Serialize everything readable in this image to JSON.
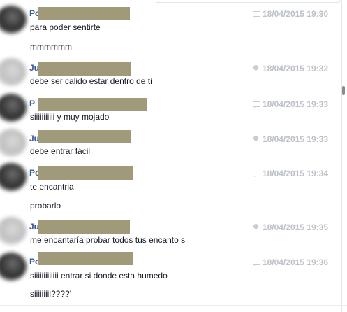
{
  "messages": [
    {
      "sender": "Po",
      "avatar": "dark",
      "icon": "chat",
      "timestamp": "18/04/2015 19:30",
      "lines": [
        "para poder sentirte",
        "mmmmmm"
      ]
    },
    {
      "sender": "Ju",
      "avatar": "light",
      "icon": "pin",
      "timestamp": "18/04/2015 19:32",
      "lines": [
        "debe ser calido estar dentro de ti"
      ]
    },
    {
      "sender": "P",
      "avatar": "dark",
      "icon": "chat",
      "timestamp": "18/04/2015 19:33",
      "lines": [
        "siiiiiiiiiii y muy mojado"
      ]
    },
    {
      "sender": "Ju",
      "avatar": "light",
      "icon": "pin",
      "timestamp": "18/04/2015 19:33",
      "lines": [
        "debe entrar fácil"
      ]
    },
    {
      "sender": "Po",
      "avatar": "dark",
      "icon": "chat",
      "timestamp": "18/04/2015 19:34",
      "lines": [
        "te encantria",
        "probarlo"
      ]
    },
    {
      "sender": "Ju",
      "avatar": "light",
      "icon": "pin",
      "timestamp": "18/04/2015 19:35",
      "lines": [
        "me encantaría probar todos tus encanto s"
      ]
    },
    {
      "sender": "Po",
      "avatar": "dark",
      "icon": "chat",
      "timestamp": "18/04/2015 19:36",
      "lines": [
        "siiiiiiiiiiiii entrar si donde esta humedo",
        "siiiiiiiii????'"
      ]
    }
  ]
}
